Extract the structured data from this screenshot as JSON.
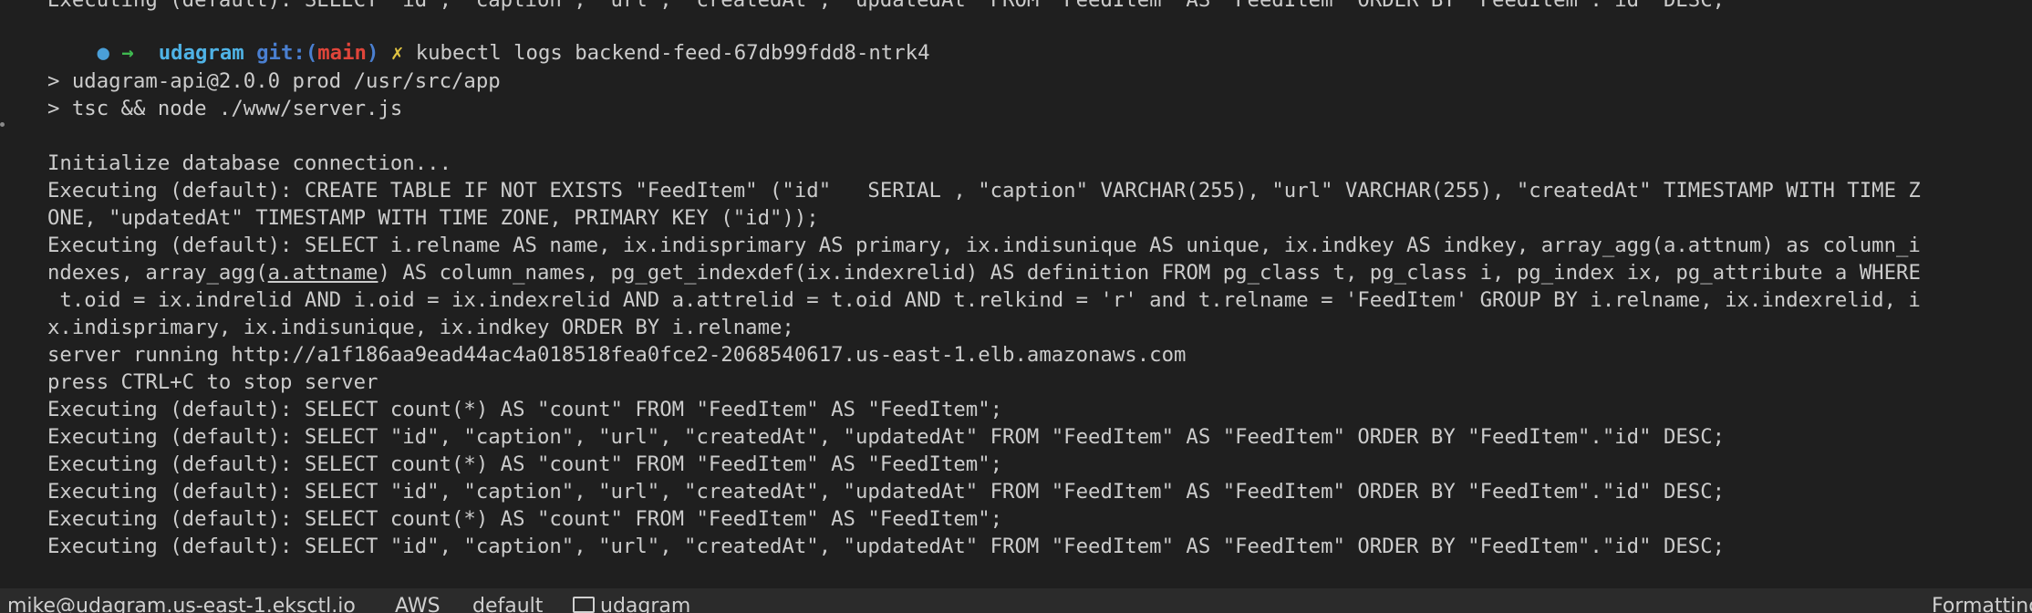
{
  "terminal": {
    "prompt": {
      "arrow": "→",
      "repo": "udagram",
      "git_label": "git:(",
      "branch": "main",
      "git_close": ")",
      "dirty": "✗"
    },
    "top_clipped_line": "Executing (default): SELECT \"id\", \"caption\", \"url\", \"createdAt\", \"updatedAt\" FROM \"FeedItem\" AS \"FeedItem\" ORDER BY \"FeedItem\".\"id\" DESC;",
    "command": "kubectl logs backend-feed-67db99fdd8-ntrk4",
    "output": {
      "l1": "> udagram-api@2.0.0 prod /usr/src/app",
      "l2": "> tsc && node ./www/server.js",
      "l3": "Initialize database connection...",
      "l4": "Executing (default): CREATE TABLE IF NOT EXISTS \"FeedItem\" (\"id\"   SERIAL , \"caption\" VARCHAR(255), \"url\" VARCHAR(255), \"createdAt\" TIMESTAMP WITH TIME Z",
      "l5": "ONE, \"updatedAt\" TIMESTAMP WITH TIME ZONE, PRIMARY KEY (\"id\"));",
      "l6": "Executing (default): SELECT i.relname AS name, ix.indisprimary AS primary, ix.indisunique AS unique, ix.indkey AS indkey, array_agg(a.attnum) as column_i",
      "l7a": "ndexes, array_agg(",
      "l7b": "a.attname",
      "l7c": ") AS column_names, pg_get_indexdef(ix.indexrelid) AS definition FROM pg_class t, pg_class i, pg_index ix, pg_attribute a WHERE",
      "l8": " t.oid = ix.indrelid AND i.oid = ix.indexrelid AND a.attrelid = t.oid AND t.relkind = 'r' and t.relname = 'FeedItem' GROUP BY i.relname, ix.indexrelid, i",
      "l9": "x.indisprimary, ix.indisunique, ix.indkey ORDER BY i.relname;",
      "l10": "server running http://a1f186aa9ead44ac4a018518fea0fce2-2068540617.us-east-1.elb.amazonaws.com",
      "l11": "press CTRL+C to stop server",
      "l12": "Executing (default): SELECT count(*) AS \"count\" FROM \"FeedItem\" AS \"FeedItem\";",
      "l13": "Executing (default): SELECT \"id\", \"caption\", \"url\", \"createdAt\", \"updatedAt\" FROM \"FeedItem\" AS \"FeedItem\" ORDER BY \"FeedItem\".\"id\" DESC;",
      "l14": "Executing (default): SELECT count(*) AS \"count\" FROM \"FeedItem\" AS \"FeedItem\";",
      "l15": "Executing (default): SELECT \"id\", \"caption\", \"url\", \"createdAt\", \"updatedAt\" FROM \"FeedItem\" AS \"FeedItem\" ORDER BY \"FeedItem\".\"id\" DESC;",
      "l16": "Executing (default): SELECT count(*) AS \"count\" FROM \"FeedItem\" AS \"FeedItem\";",
      "l17": "Executing (default): SELECT \"id\", \"caption\", \"url\", \"createdAt\", \"updatedAt\" FROM \"FeedItem\" AS \"FeedItem\" ORDER BY \"FeedItem\".\"id\" DESC;"
    }
  },
  "statusbar": {
    "context": "mike@udagram.us-east-1.eksctl.io",
    "aws": "AWS",
    "profile": "default",
    "folder": "udagram",
    "right": "Formatting"
  },
  "colors": {
    "background": "#1f1f1f",
    "text": "#cccccc",
    "prompt_arrow": "#3fb950",
    "repo": "#4fb3e6",
    "branch": "#e0453a",
    "dirty": "#e0c341"
  }
}
